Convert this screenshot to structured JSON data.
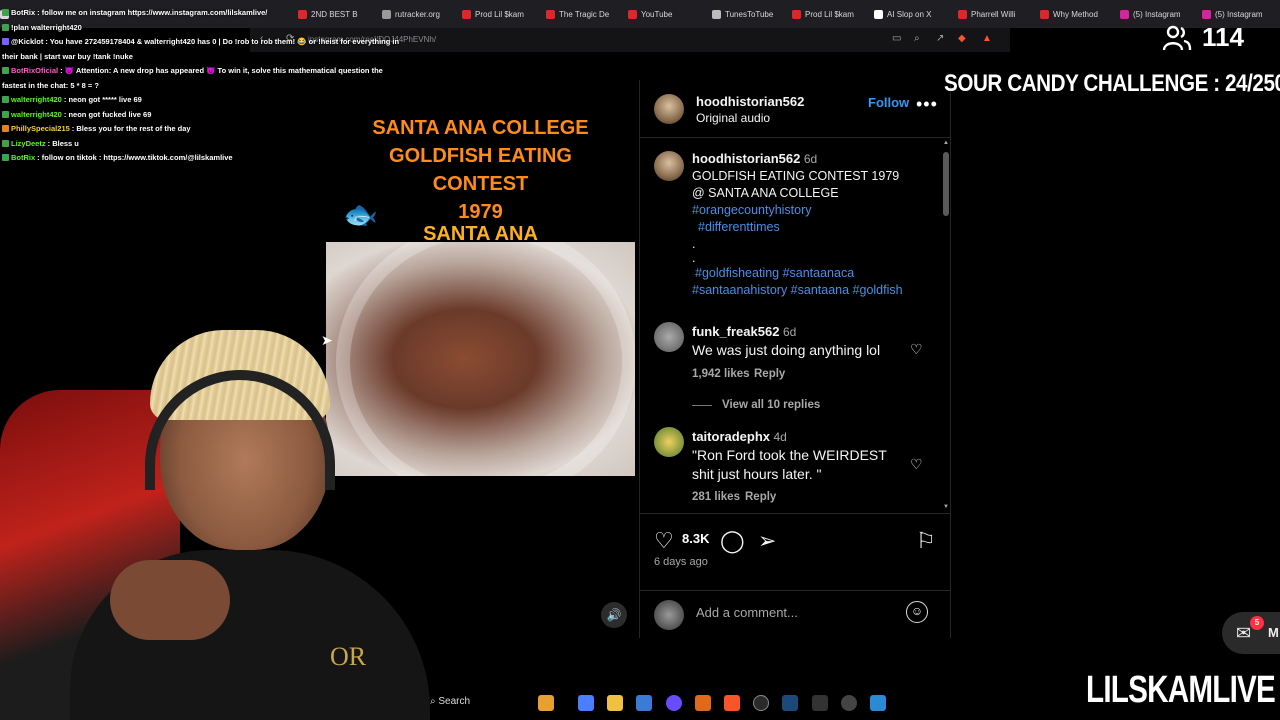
{
  "browser": {
    "tabs": [
      {
        "label": "",
        "color": "#d9d9d9"
      },
      {
        "label": "2ND BEST B",
        "color": "#e0252c"
      },
      {
        "label": "rutracker.org",
        "color": "#9a9a9a"
      },
      {
        "label": "Prod Lil $kam",
        "color": "#e0252c"
      },
      {
        "label": "The Tragic De",
        "color": "#e0252c"
      },
      {
        "label": "YouTube",
        "color": "#e0252c"
      },
      {
        "label": "TunesToTube",
        "color": "#bbbbbb"
      },
      {
        "label": "Prod Lil $kam",
        "color": "#e0252c"
      },
      {
        "label": "AI Slop on X",
        "color": "#ffffff"
      },
      {
        "label": "Pharrell Willi",
        "color": "#e0252c"
      },
      {
        "label": "Why Method",
        "color": "#e0252c"
      },
      {
        "label": "(5) Instagram",
        "color": "#d6249f"
      },
      {
        "label": "(5) Instagram",
        "color": "#d6249f"
      }
    ],
    "url": "instagram.com/reel/DQJ44PhEVNh/"
  },
  "chat": [
    {
      "user": "BotRix",
      "color": "#ffffff",
      "badge": "#3fa34d",
      "text": "follow me on instagram https://www.instagram.com/lilskamlive/"
    },
    {
      "user": "",
      "color": "#ff4d4d",
      "badge": "#3fa34d",
      "text": "!plan walterright420"
    },
    {
      "user": "@Kicklot",
      "color": "#ffffff",
      "badge": "#7b61ff",
      "text": "You have 272459178404 & walterright420 has 0 | Do !rob to rob them! 😂 or !heist for everything in"
    },
    {
      "user": "",
      "color": "#ffffff",
      "badge": "",
      "text": "their bank | start war buy !tank !nuke"
    },
    {
      "user": "BotRixOficial",
      "color": "#ff5ac8",
      "badge": "#3fa34d",
      "text": "😈 Attention: A new drop has appeared 😈 To win it, solve this mathematical question the"
    },
    {
      "user": "",
      "color": "#ffffff",
      "badge": "",
      "text": "fastest in the chat: 5 * 8 = ?"
    },
    {
      "user": "walterright420",
      "color": "#53fc18",
      "badge": "#3fa34d",
      "text": "neon got ***** live 69"
    },
    {
      "user": "walterright420",
      "color": "#53fc18",
      "badge": "#3fa34d",
      "text": "neon got fucked live 69"
    },
    {
      "user": "PhillySpecial215",
      "color": "#f4d03f",
      "badge": "#e67e22",
      "text": "Bless you for the rest of the day"
    },
    {
      "user": "LizyDeetz",
      "color": "#53fc18",
      "badge": "#3fa34d",
      "text": "Bless u"
    },
    {
      "user": "BotRix",
      "color": "#53fc18",
      "badge": "#3fa34d",
      "text": "follow on tiktok : https://www.tiktok.com/@lilskamlive"
    }
  ],
  "overlay": {
    "viewer_count": "114",
    "challenge": "SOUR CANDY CHALLENGE : 24/250",
    "brand": "LILSKAMLIVE",
    "shirt_text": "OR"
  },
  "video": {
    "title_lines": [
      "SANTA ANA COLLEGE",
      "GOLDFISH EATING",
      "CONTEST",
      "1979",
      "SANTA ANA"
    ],
    "fish_icon": "🐟",
    "mute_icon": "🔊"
  },
  "post": {
    "username": "hoodhistorian562",
    "audio": "Original audio",
    "follow_label": "Follow",
    "more_icon": "•••",
    "caption_user": "hoodhistorian562",
    "caption_age": "6d",
    "caption_line1": "GOLDFISH EATING CONTEST 1979",
    "caption_line2": "@ SANTA ANA COLLEGE",
    "tag1": "#orangecountyhistory",
    "tag2": "#differenttimes",
    "dot1": ".",
    "dot2": ".",
    "tag3": "#goldfisheating #santaanaca",
    "tag4": "#santaanahistory #santaana #goldfish",
    "comments": [
      {
        "user": "funk_freak562",
        "age": "6d",
        "text": "We was just doing anything lol",
        "likes": "1,942 likes",
        "reply": "Reply",
        "replies": "View all 10 replies"
      },
      {
        "user": "taitoradephx",
        "age": "4d",
        "text": "\"Ron Ford took the WEIRDEST",
        "text2": "shit just hours later. \"",
        "likes": "281 likes",
        "reply": "Reply"
      }
    ],
    "likes": "8.3K",
    "posted": "6 days ago",
    "add_comment": "Add a comment..."
  },
  "taskbar": {
    "search": "Search"
  },
  "messenger": {
    "badge": "5",
    "label": "M"
  }
}
